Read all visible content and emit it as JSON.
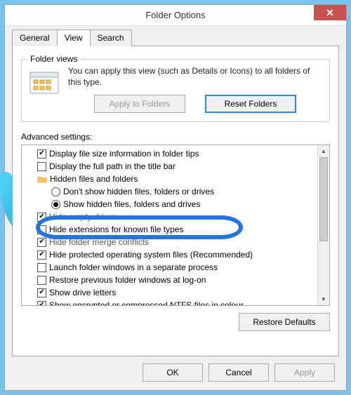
{
  "title": "Folder Options",
  "close_glyph": "✕",
  "tabs": {
    "general": "General",
    "view": "View",
    "search": "Search"
  },
  "folder_views": {
    "group_label": "Folder views",
    "description": "You can apply this view (such as Details or Icons) to all folders of this type.",
    "apply_btn": "Apply to Folders",
    "reset_btn": "Reset Folders"
  },
  "advanced": {
    "label": "Advanced settings:",
    "items": [
      {
        "indent": 1,
        "type": "check",
        "checked": true,
        "label": "Display file size information in folder tips"
      },
      {
        "indent": 1,
        "type": "check",
        "checked": false,
        "label": "Display the full path in the title bar"
      },
      {
        "indent": 1,
        "type": "folder",
        "checked": false,
        "label": "Hidden files and folders"
      },
      {
        "indent": 2,
        "type": "radio",
        "checked": false,
        "label": "Don't show hidden files, folders or drives"
      },
      {
        "indent": 2,
        "type": "radio",
        "checked": true,
        "label": "Show hidden files, folders and drives"
      },
      {
        "indent": 1,
        "type": "check",
        "checked": true,
        "label": "Hide empty drives"
      },
      {
        "indent": 1,
        "type": "check",
        "checked": false,
        "label": "Hide extensions for known file types"
      },
      {
        "indent": 1,
        "type": "check",
        "checked": true,
        "label": "Hide folder merge conflicts"
      },
      {
        "indent": 1,
        "type": "check",
        "checked": true,
        "label": "Hide protected operating system files (Recommended)"
      },
      {
        "indent": 1,
        "type": "check",
        "checked": false,
        "label": "Launch folder windows in a separate process"
      },
      {
        "indent": 1,
        "type": "check",
        "checked": false,
        "label": "Restore previous folder windows at log-on"
      },
      {
        "indent": 1,
        "type": "check",
        "checked": true,
        "label": "Show drive letters"
      },
      {
        "indent": 1,
        "type": "check",
        "checked": true,
        "label": "Show encrypted or compressed NTFS files in colour"
      }
    ],
    "restore_btn": "Restore Defaults"
  },
  "dialog_buttons": {
    "ok": "OK",
    "cancel": "Cancel",
    "apply": "Apply"
  }
}
